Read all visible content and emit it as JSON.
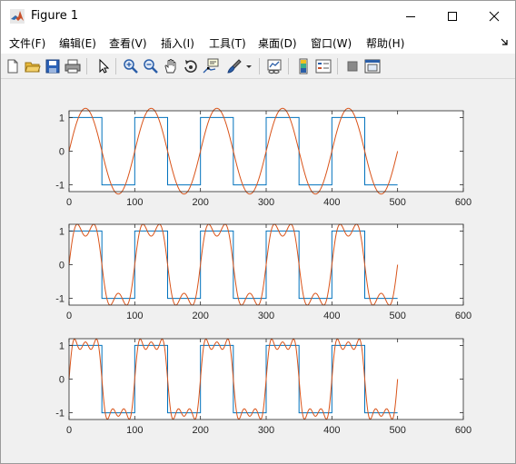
{
  "window": {
    "title": "Figure 1",
    "app_icon": "matlab-icon"
  },
  "window_controls": [
    "minimize-icon",
    "maximize-icon",
    "close-icon"
  ],
  "menu": {
    "items": [
      "文件(F)",
      "编辑(E)",
      "查看(V)",
      "插入(I)",
      "工具(T)",
      "桌面(D)",
      "窗口(W)",
      "帮助(H)"
    ],
    "overflow_icon": "expand-arrow-icon"
  },
  "toolbar": {
    "buttons": [
      "new-figure-icon",
      "open-file-icon",
      "save-icon",
      "print-icon",
      "pointer-icon",
      "zoom-in-icon",
      "zoom-out-icon",
      "pan-hand-icon",
      "rotate-3d-icon",
      "data-cursor-icon",
      "brush-icon",
      "brush-dropdown-icon",
      "link-plot-icon",
      "colorbar-icon",
      "legend-icon",
      "hide-plot-tools-icon",
      "show-plot-tools-icon"
    ]
  },
  "colors": {
    "square_wave": "#0072bd",
    "fourier_sum": "#d95319",
    "axes": "#262626",
    "background": "#f0f0f0"
  },
  "chart_data": [
    {
      "type": "line",
      "title": "",
      "xlabel": "",
      "ylabel": "",
      "xlim": [
        0,
        600
      ],
      "ylim": [
        -1.2,
        1.2
      ],
      "xticks": [
        0,
        100,
        200,
        300,
        400,
        500,
        600
      ],
      "yticks": [
        -1,
        0,
        1
      ],
      "xtick_labels": [
        "0",
        "100",
        "200",
        "300",
        "400",
        "500",
        "600"
      ],
      "ytick_labels": [
        "-1",
        "0",
        "1"
      ],
      "grid": false,
      "box": true,
      "series": [
        {
          "kind": "square",
          "color": "#0072bd",
          "period": 100,
          "amplitude": 1,
          "x_range": [
            0,
            500
          ]
        },
        {
          "kind": "fourier_partial_sum",
          "color": "#d95319",
          "period": 100,
          "harmonics": [
            1
          ],
          "x_range": [
            0,
            500
          ]
        }
      ]
    },
    {
      "type": "line",
      "title": "",
      "xlabel": "",
      "ylabel": "",
      "xlim": [
        0,
        600
      ],
      "ylim": [
        -1.2,
        1.2
      ],
      "xticks": [
        0,
        100,
        200,
        300,
        400,
        500,
        600
      ],
      "yticks": [
        -1,
        0,
        1
      ],
      "xtick_labels": [
        "0",
        "100",
        "200",
        "300",
        "400",
        "500",
        "600"
      ],
      "ytick_labels": [
        "-1",
        "0",
        "1"
      ],
      "grid": false,
      "box": true,
      "series": [
        {
          "kind": "square",
          "color": "#0072bd",
          "period": 100,
          "amplitude": 1,
          "x_range": [
            0,
            500
          ]
        },
        {
          "kind": "fourier_partial_sum",
          "color": "#d95319",
          "period": 100,
          "harmonics": [
            1,
            3
          ],
          "x_range": [
            0,
            500
          ]
        }
      ]
    },
    {
      "type": "line",
      "title": "",
      "xlabel": "",
      "ylabel": "",
      "xlim": [
        0,
        600
      ],
      "ylim": [
        -1.2,
        1.2
      ],
      "xticks": [
        0,
        100,
        200,
        300,
        400,
        500,
        600
      ],
      "yticks": [
        -1,
        0,
        1
      ],
      "xtick_labels": [
        "0",
        "100",
        "200",
        "300",
        "400",
        "500",
        "600"
      ],
      "ytick_labels": [
        "-1",
        "0",
        "1"
      ],
      "grid": false,
      "box": true,
      "series": [
        {
          "kind": "square",
          "color": "#0072bd",
          "period": 100,
          "amplitude": 1,
          "x_range": [
            0,
            500
          ]
        },
        {
          "kind": "fourier_partial_sum",
          "color": "#d95319",
          "period": 100,
          "harmonics": [
            1,
            3,
            5
          ],
          "x_range": [
            0,
            500
          ]
        }
      ]
    }
  ]
}
